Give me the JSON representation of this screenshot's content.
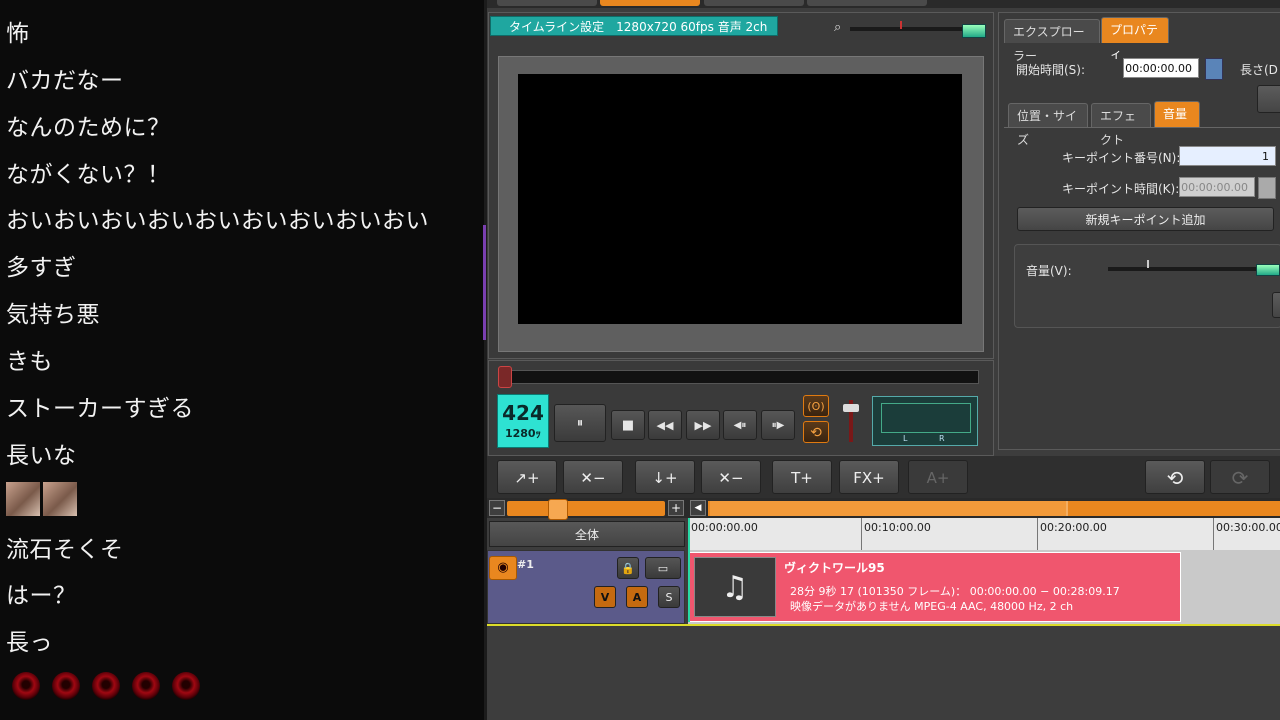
{
  "comments": [
    {
      "text": "怖"
    },
    {
      "text": "バカだなー"
    },
    {
      "text": "なんのために？"
    },
    {
      "text": "ながくない？！"
    },
    {
      "text": "おいおいおいおいおいおいおいおいおい"
    },
    {
      "text": "多すぎ"
    },
    {
      "text": "気持ち悪"
    },
    {
      "text": "きも"
    },
    {
      "text": "ストーカーすぎる"
    },
    {
      "text": "長いな"
    },
    {
      "text": "流石そくそ"
    },
    {
      "text": "はー？"
    },
    {
      "text": "長っ"
    }
  ],
  "preview": {
    "timeline_tab": "タイムライン設定　1280x720 60fps 音声 2ch",
    "counter_main": "424",
    "counter_sub": "1280ｯ"
  },
  "transport": {
    "pause": "⏸",
    "stop": "■",
    "rewind": "◀◀",
    "forward": "▶▶",
    "step_back": "◀⏸",
    "step_fwd": "⏸▶",
    "audio_icon": "(ʘ)",
    "loop_icon": "⟲",
    "meter_l": "L",
    "meter_r": "R"
  },
  "properties": {
    "tab_explorer": "エクスプローラー",
    "tab_property": "プロパティ",
    "start_time_label": "開始時間(S):",
    "start_time_value": "00:00:00.00",
    "length_label": "長さ(D",
    "subtab_position": "位置・サイズ",
    "subtab_effect": "エフェクト",
    "subtab_volume": "音量",
    "keypoint_no_label": "キーポイント番号(N):",
    "keypoint_no_value": "1",
    "keypoint_time_label": "キーポイント時間(K):",
    "keypoint_time_value": "00:00:00.00",
    "add_keypoint": "新規キーポイント追加",
    "volume_label": "音量(V):"
  },
  "timeline": {
    "all_label": "全体",
    "ruler_labels": [
      "00:00:00.00",
      "00:10:00.00",
      "00:20:00.00",
      "00:30:00.00"
    ],
    "track_name": "#1",
    "btn_v": "V",
    "btn_a": "A",
    "btn_s": "S",
    "clip_title": "ヴィクトワール95",
    "clip_line1": "28分 9秒 17 (101350 フレーム)： 00:00:00.00 − 00:28:09.17",
    "clip_line2": "映像データがありません  MPEG-4 AAC,  48000 Hz,  2 ch",
    "music_icon": "♫"
  },
  "toolbar": {
    "t1": "↗+",
    "t2": "✕−",
    "t3": "↓+",
    "t4": "✕−",
    "t5": "T+",
    "t6": "FX+",
    "t7": "A+"
  },
  "colors": {
    "accent": "#e9871f",
    "teal": "#1fa7a0",
    "clip": "#f0566e"
  }
}
